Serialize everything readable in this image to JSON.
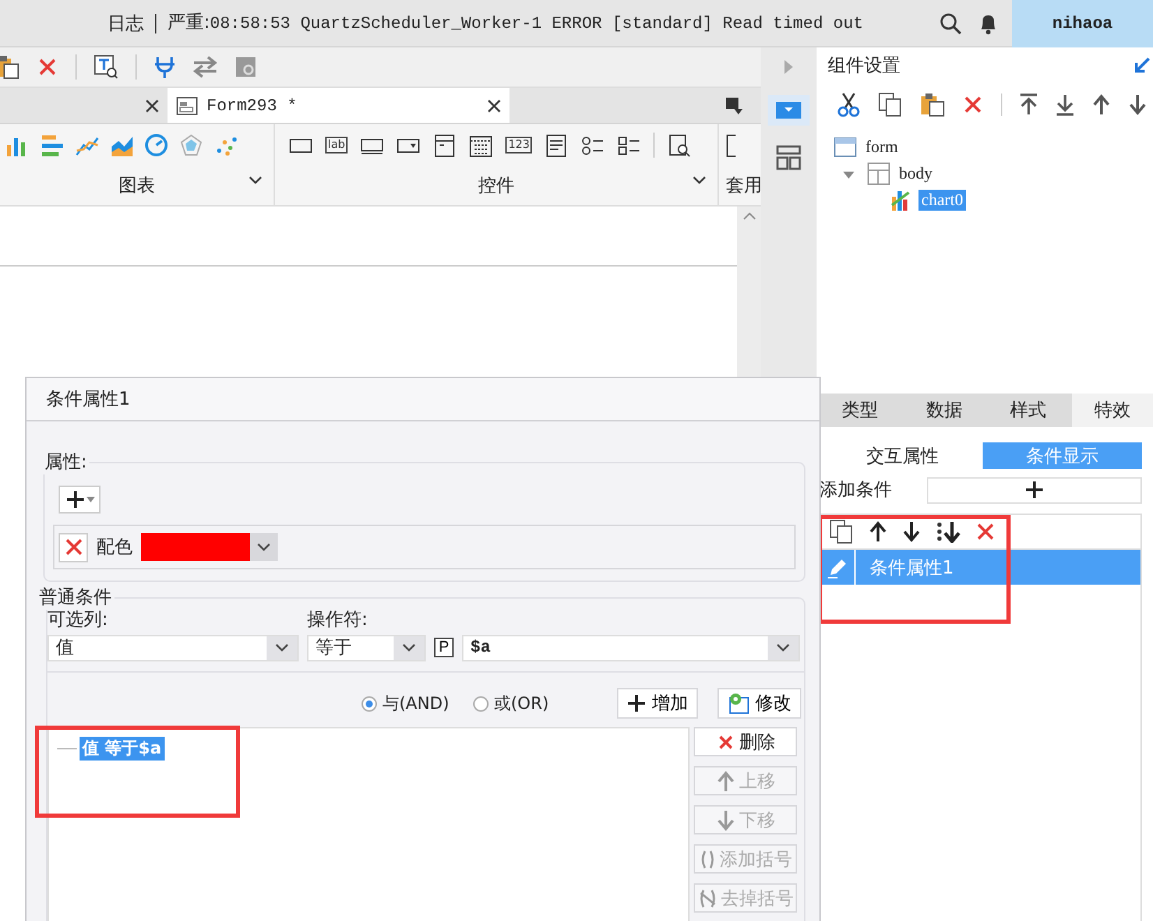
{
  "status_bar": {
    "log_label": "日志",
    "severity_label": "严重:",
    "message": "08:58:53 QuartzScheduler_Worker-1 ERROR [standard] Read timed out",
    "user": "nihaoa"
  },
  "editor_tabs": [
    {
      "kind": "blank",
      "selected": false
    },
    {
      "kind": "form",
      "label": "Form293 *",
      "selected": true
    }
  ],
  "ribbon": {
    "groups": [
      {
        "label": "图表"
      },
      {
        "label": "控件"
      },
      {
        "label": "套用"
      }
    ],
    "label_icon_text": "lab",
    "number_icon_text": "123"
  },
  "settings_panel": {
    "title": "组件设置",
    "tree": [
      {
        "label": "form",
        "kind": "form",
        "selected": false,
        "children": [
          {
            "label": "body",
            "kind": "body",
            "selected": false,
            "expanded": true,
            "children": [
              {
                "label": "chart0",
                "kind": "chart",
                "selected": true
              }
            ]
          }
        ]
      }
    ],
    "tabs": [
      {
        "label": "类型",
        "selected": false
      },
      {
        "label": "数据",
        "selected": false
      },
      {
        "label": "样式",
        "selected": false
      },
      {
        "label": "特效",
        "selected": true
      }
    ],
    "sub_tabs": [
      {
        "label": "交互属性",
        "selected": false
      },
      {
        "label": "条件显示",
        "selected": true
      }
    ],
    "add_condition_label": "添加条件",
    "condition_list": {
      "highlighted": true,
      "items": [
        {
          "label": "条件属性1",
          "selected": true
        }
      ]
    }
  },
  "dialog": {
    "title": "条件属性1",
    "property_section": {
      "title": "属性:",
      "properties": [
        {
          "label": "配色",
          "color": "#ff0000"
        }
      ]
    },
    "condition_section": {
      "title": "普通条件",
      "column_label": "可选列:",
      "column_value": "值",
      "operator_label": "操作符:",
      "operator_value": "等于",
      "param_button": "P",
      "value": "$a",
      "logic": [
        {
          "label": "与(AND)",
          "selected": true
        },
        {
          "label": "或(OR)",
          "selected": false
        }
      ],
      "action_buttons": [
        {
          "kind": "add",
          "label": "增加"
        },
        {
          "kind": "edit",
          "label": "修改"
        }
      ],
      "conditions": {
        "highlighted": true,
        "items": [
          {
            "label": "值 等于$a",
            "selected": true
          }
        ]
      },
      "side_buttons": [
        {
          "kind": "delete",
          "label": "删除",
          "disabled": false
        },
        {
          "kind": "up",
          "label": "上移",
          "disabled": true
        },
        {
          "kind": "down",
          "label": "下移",
          "disabled": true
        },
        {
          "kind": "add-bracket",
          "label": "添加括号",
          "disabled": true
        },
        {
          "kind": "remove-bracket",
          "label": "去掉括号",
          "disabled": true
        }
      ]
    }
  }
}
